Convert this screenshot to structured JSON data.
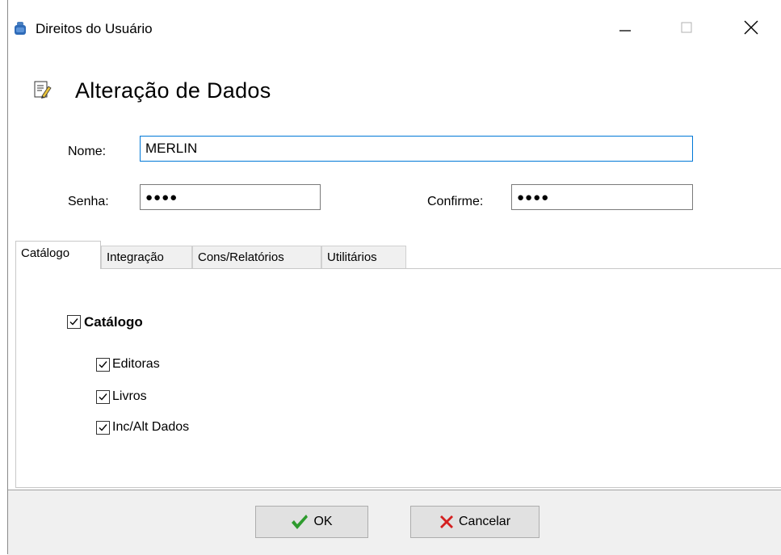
{
  "window": {
    "title": "Direitos do Usuário",
    "controls": [
      "minimize-icon",
      "maximize-icon",
      "close-icon"
    ]
  },
  "header": {
    "title": "Alteração de Dados",
    "icon": "edit-document-icon"
  },
  "form": {
    "nome_label": "Nome:",
    "nome_value": "MERLIN",
    "senha_label": "Senha:",
    "senha_value": "●●●●",
    "confirme_label": "Confirme:",
    "confirme_value": "●●●●"
  },
  "tabs": [
    {
      "label": "Catálogo",
      "active": true
    },
    {
      "label": "Integração",
      "active": false
    },
    {
      "label": "Cons/Relatórios",
      "active": false
    },
    {
      "label": "Utilitários",
      "active": false
    }
  ],
  "catalogo": {
    "group": {
      "label": "Catálogo",
      "checked": true
    },
    "items": [
      {
        "label": "Editoras",
        "checked": true
      },
      {
        "label": "Livros",
        "checked": true
      },
      {
        "label": "Inc/Alt Dados",
        "checked": true
      }
    ]
  },
  "buttons": {
    "ok_label": "OK",
    "cancel_label": "Cancelar"
  },
  "colors": {
    "focus_border": "#0078d7",
    "ok_check": "#2e9b2e",
    "cancel_x": "#d42020"
  }
}
